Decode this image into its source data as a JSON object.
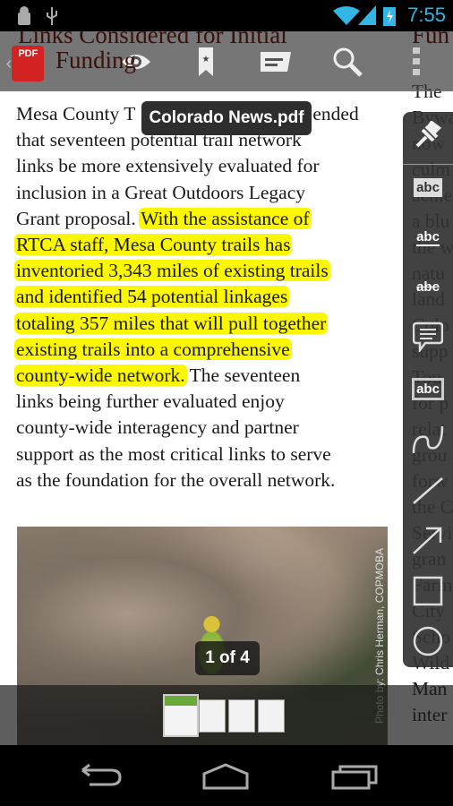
{
  "status_bar": {
    "time": "7:55",
    "icons": [
      "android-debug-icon",
      "usb-icon",
      "wifi-icon",
      "signal-icon",
      "battery-charging-icon"
    ]
  },
  "document": {
    "file_name": "Colorado News.pdf",
    "heading_left": [
      "Links Considered for Initial",
      "Funding"
    ],
    "heading_right": "Fun",
    "body_lines": [
      {
        "parts": [
          {
            "t": "Mesa County T",
            "h": false
          },
          {
            "t": "ended",
            "h": false
          }
        ]
      },
      {
        "parts": [
          {
            "t": "that seventeen potential trail network",
            "h": false
          }
        ]
      },
      {
        "parts": [
          {
            "t": "links be more extensively evaluated for",
            "h": false
          }
        ]
      },
      {
        "parts": [
          {
            "t": "inclusion in a Great Outdoors Legacy",
            "h": false
          }
        ]
      },
      {
        "parts": [
          {
            "t": "Grant proposal. ",
            "h": false
          },
          {
            "t": "With the assistance of",
            "h": true
          }
        ]
      },
      {
        "parts": [
          {
            "t": "RTCA staff, Mesa County trails has",
            "h": true
          }
        ]
      },
      {
        "parts": [
          {
            "t": "inventoried 3,343 miles of existing trails",
            "h": true
          }
        ]
      },
      {
        "parts": [
          {
            "t": "and identified 54 potential linkages",
            "h": true
          }
        ]
      },
      {
        "parts": [
          {
            "t": "totaling 357 miles that will pull together",
            "h": true
          }
        ]
      },
      {
        "parts": [
          {
            "t": "existing trails into a comprehensive",
            "h": true
          }
        ]
      },
      {
        "parts": [
          {
            "t": "county-wide network.",
            "h": true
          },
          {
            "t": " The seventeen",
            "h": false
          }
        ]
      },
      {
        "parts": [
          {
            "t": "links being further evaluated enjoy",
            "h": false
          }
        ]
      },
      {
        "parts": [
          {
            "t": "county-wide interagency and partner",
            "h": false
          }
        ]
      },
      {
        "parts": [
          {
            "t": "support as the most critical links to serve",
            "h": false
          }
        ]
      },
      {
        "parts": [
          {
            "t": "as the foundation for the overall network.",
            "h": false
          }
        ]
      }
    ],
    "right_column": [
      "The",
      "Byway",
      "now",
      "culm",
      "achie",
      "a blu",
      "the w",
      "natu",
      "land",
      "Colo",
      "supp",
      "Tou",
      "for p",
      "relat",
      "grou",
      "forw",
      "the C",
      "Servi",
      "gran",
      "Farm",
      "City",
      "Scho",
      "Wild",
      "Man",
      "inter"
    ],
    "photo_credit": "Photo by: Chris Herman, COPMOBA",
    "highlight_color": "#fbf701"
  },
  "toolbar": {
    "app_icon_label": "PDF",
    "buttons": [
      "eye-icon",
      "bookmark-icon",
      "comment-list-icon",
      "search-icon",
      "overflow-menu-icon"
    ]
  },
  "annotation_tools": {
    "abc": "abc",
    "tools": [
      "pin",
      "highlight",
      "underline",
      "strikethrough",
      "note",
      "textbox",
      "freehand",
      "line",
      "arrow",
      "rectangle",
      "oval"
    ]
  },
  "pager": {
    "current": 1,
    "total": 4,
    "label": "1 of 4"
  }
}
